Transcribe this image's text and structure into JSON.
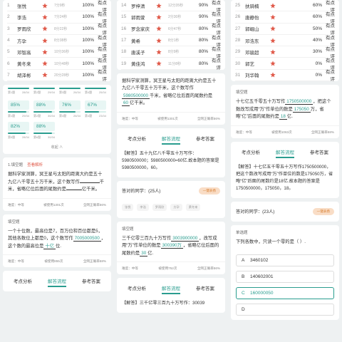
{
  "ranking_left": [
    {
      "n": "1",
      "name": "张悦",
      "time": "7分9秒",
      "pct": "100%",
      "comment": "有点评"
    },
    {
      "n": "2",
      "name": "李浩",
      "time": "7分24秒",
      "pct": "100%",
      "comment": "有点评"
    },
    {
      "n": "3",
      "name": "罗雨欣",
      "time": "8分22秒",
      "pct": "100%",
      "comment": "有点评"
    },
    {
      "n": "4",
      "name": "方孕",
      "time": "8分38秒",
      "pct": "100%",
      "comment": "有点评"
    },
    {
      "n": "5",
      "name": "邓智高",
      "time": "10分36秒",
      "pct": "100%",
      "comment": "有点评"
    },
    {
      "n": "6",
      "name": "黄冬来",
      "time": "10分48秒",
      "pct": "100%",
      "comment": "有点评"
    },
    {
      "n": "7",
      "name": "胡泽彬",
      "time": "20分28秒",
      "pct": "100%",
      "comment": "有点评"
    }
  ],
  "ranking_mid": [
    {
      "n": "14",
      "name": "罗梓清",
      "time": "12分35秒",
      "pct": "90%",
      "comment": "有点评"
    },
    {
      "n": "15",
      "name": "郭雨萱",
      "time": "2分30秒",
      "pct": "90%",
      "comment": "有点评"
    },
    {
      "n": "16",
      "name": "罗念家庆",
      "time": "6分47秒",
      "pct": "80%",
      "comment": "有点评"
    },
    {
      "n": "17",
      "name": "黄希",
      "time": "8分1秒",
      "pct": "80%",
      "comment": "有点评"
    },
    {
      "n": "18",
      "name": "唐溪子",
      "time": "8分9秒",
      "pct": "80%",
      "comment": "有点评"
    },
    {
      "n": "19",
      "name": "黄佳鸿",
      "time": "11分8秒",
      "pct": "80%",
      "comment": "有点评"
    }
  ],
  "ranking_right": [
    {
      "n": "25",
      "name": "扶骑楠",
      "time": "",
      "pct": "60%",
      "comment": "有点评"
    },
    {
      "n": "26",
      "name": "唐静怡",
      "time": "",
      "pct": "60%",
      "comment": "有点评"
    },
    {
      "n": "27",
      "name": "郭崛山",
      "time": "",
      "pct": "50%",
      "comment": "有点评"
    },
    {
      "n": "28",
      "name": "邓浩东",
      "time": "",
      "pct": "40%",
      "comment": "有点评"
    },
    {
      "n": "29",
      "name": "邓骏超",
      "time": "",
      "pct": "30%",
      "comment": "有点评"
    },
    {
      "n": "30",
      "name": "郭艺",
      "time": "",
      "pct": "0%",
      "comment": "有点评"
    },
    {
      "n": "31",
      "name": "刘华翰",
      "time": "",
      "pct": "0%",
      "comment": "有点评"
    }
  ],
  "stats_grid": {
    "cells": [
      {
        "num": "85%",
        "label_l": "第1题",
        "label_r": "29/34",
        "fill": 0.85
      },
      {
        "num": "88%",
        "label_l": "第2题",
        "label_r": "30/34",
        "fill": 0.88
      },
      {
        "num": "76%",
        "label_l": "第3题",
        "label_r": "26/34",
        "fill": 0.76
      },
      {
        "num": "67%",
        "label_l": "第4题",
        "label_r": "23/34",
        "fill": 0.67
      },
      {
        "num": "82%",
        "label_l": "第5题",
        "label_r": "28/34",
        "fill": 0.82
      },
      {
        "num": "88%",
        "label_l": "第6题",
        "label_r": "30/34",
        "fill": 0.88
      }
    ],
    "top_labels": [
      [
        "第1题",
        "28/34"
      ],
      [
        "第2题",
        "29/34"
      ],
      [
        "第3题",
        "26/34"
      ],
      [
        "第4题",
        "25/34"
      ]
    ],
    "more_label": "收起 ∧"
  },
  "q_fill_left": {
    "type": "1.填空题",
    "tag": "查看解析",
    "text_a": "据科学家测算，冥王星与太阳的距离大约是五十九亿八千零五十万千米，这个数写作",
    "blank1": "",
    "text_b": "千米，省略亿位后面的尾数约是",
    "blank2": "",
    "text_c": "亿千米。",
    "meta_l": "难度：中等",
    "meta_m": "被使用1301次",
    "meta_r": "全网正确率56%"
  },
  "q_digits": {
    "type": "填空题",
    "text_a": "一个十位数，最高位是7，百万位和百位都是5，其他各数位上都是0，这个数写作",
    "blank1": "7005000500",
    "text_b": "，这个数的最高位是",
    "blank2": "十亿",
    "text_c": "位.",
    "meta_l": "难度：中等",
    "meta_m": "被使用855次",
    "meta_r": "全网正确率58%"
  },
  "q_pluto_ans": {
    "text_a": "据科学家测算，冥王星与太阳的距离大约是五十九亿八千零五十万千米，这个数写作",
    "blank1": "5980500000",
    "text_b": "千米，省略亿位后面的尾数约是",
    "blank2": "60",
    "text_c": "亿千米。",
    "meta_l": "难度：中等",
    "meta_m": "被使用1301次",
    "meta_r": "全网正确率56%"
  },
  "q_pluto_expl": "【解答】五十九亿八千零五十万写作：5980500000；5980500000≈60亿.故本题的答案是5980500000，60。",
  "q_pluto_count": "答对的同学：(25人)",
  "q_pluto_pill": "一键表扬",
  "q_pluto_chips": [
    "张悦",
    "李浩",
    "罗雨欣",
    "方孕",
    "黄冬来"
  ],
  "q_303": {
    "type": "填空题",
    "text_a": "三千亿零三百九十万写作",
    "blank1": "3003900000",
    "text_b": "，改写成用“万”作单位的数是",
    "blank2": "300390万",
    "text_c": "，省略亿位后面的尾数约是",
    "blank3": "30",
    "text_d": "亿.",
    "meta_l": "难度：中等",
    "meta_m": "被使用752次",
    "meta_r": "全网正确率56%"
  },
  "q_303_expl": "【解答】三千亿零三百九十万写作：30039",
  "q_175": {
    "type": "填空题",
    "text_a": "十七亿五千零五十万写作",
    "blank1": "1750500000",
    "text_b": "，把这个数改写成用“万”作单位的数是",
    "blank2": "175050",
    "text_c": "万，省略“亿”后面的尾数约是",
    "blank3": "18",
    "text_d": "亿.",
    "meta_l": "难度：中等",
    "meta_m": "被使用1063次",
    "meta_r": "全网正确率58%"
  },
  "q_175_expl": "【解答】十七亿五千零五十万写作1750500000，把这个数改写成用“万”作单位的数是175050万，省略“亿”后面的尾数约是18亿.故本题的答案是1750500000，175050，18。",
  "q_175_count": "答对的同学：(23人)",
  "q_175_pill": "一键表扬",
  "q_choice": {
    "type": "单选题",
    "stem": "下列各数中，只读一个零的是（    ）.",
    "options": [
      {
        "k": "A",
        "v": "3460102"
      },
      {
        "k": "B",
        "v": "140602001"
      },
      {
        "k": "C",
        "v": "160000050"
      },
      {
        "k": "D",
        "v": ""
      }
    ]
  },
  "tabs": {
    "a": "考点分析",
    "b": "解答流程",
    "c": "参考答案"
  },
  "colors": {
    "accent": "#2a9d8f",
    "badge": "#e05a4a"
  }
}
